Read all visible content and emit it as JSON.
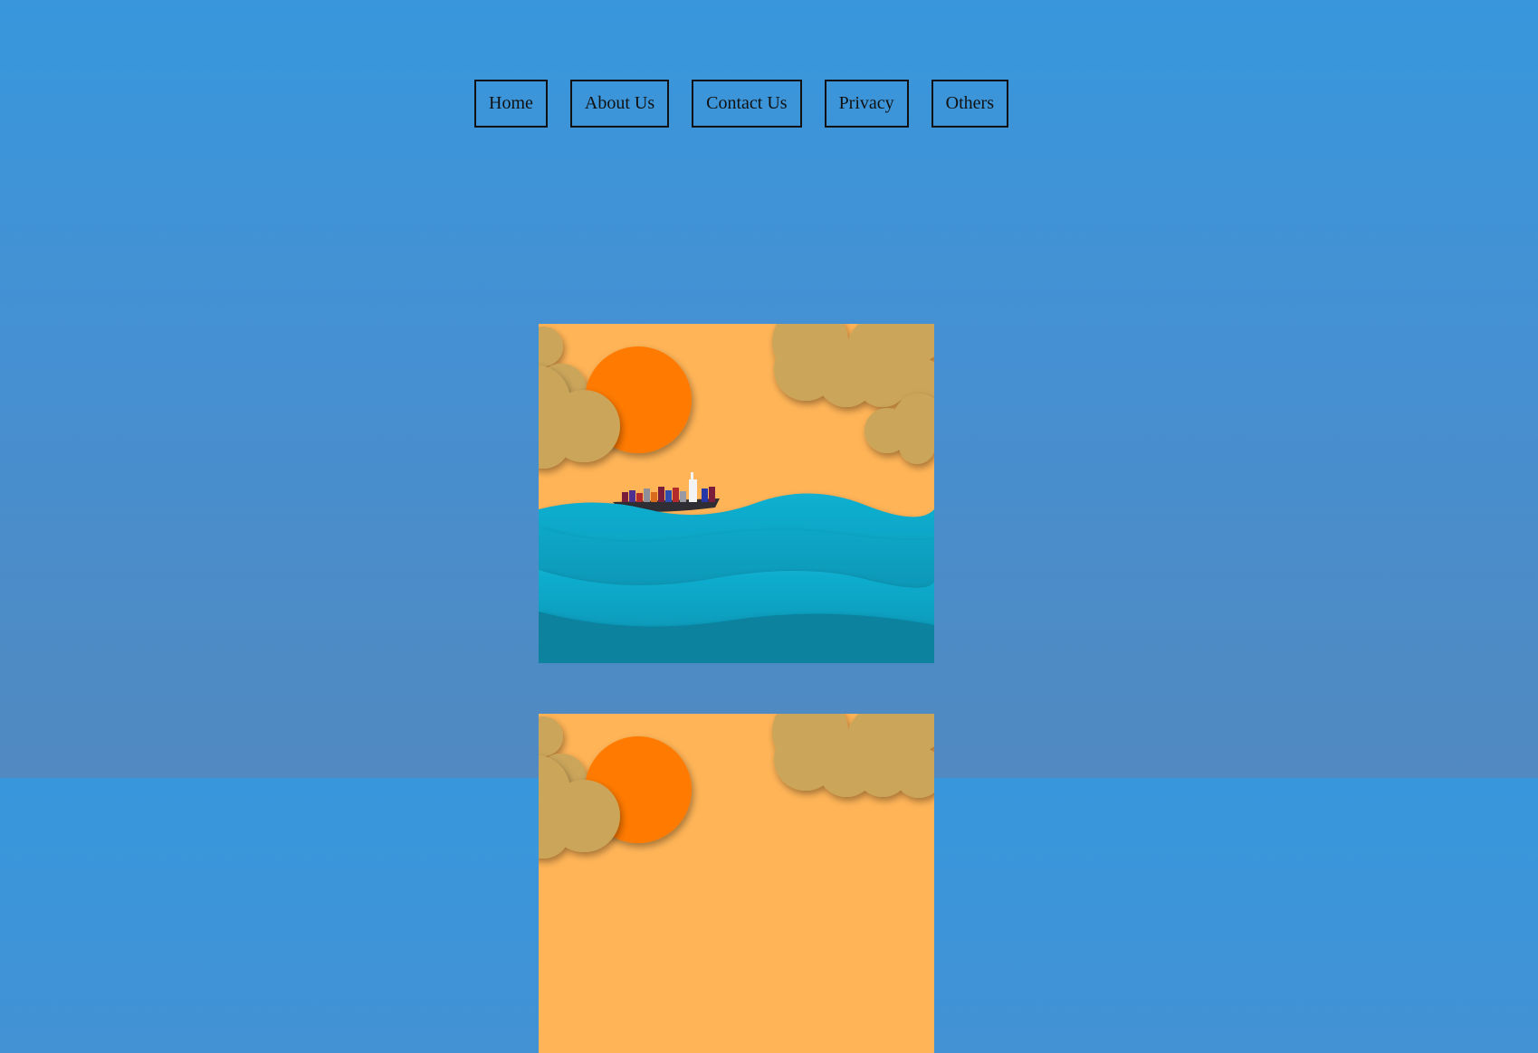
{
  "nav": {
    "items": [
      {
        "label": "Home"
      },
      {
        "label": "About Us"
      },
      {
        "label": "Contact Us"
      },
      {
        "label": "Privacy"
      },
      {
        "label": "Others"
      }
    ]
  },
  "colors": {
    "background_top": "#3897dc",
    "background_bottom": "#5189c0",
    "sky": "#ffb457",
    "sun": "#ff7a00",
    "cloud": "#caa55a",
    "sea_light": "#0aa0c2",
    "sea_deep": "#07829f"
  },
  "artwork": [
    {
      "subject": "paper-cut-seascape-with-cargo-ship"
    },
    {
      "subject": "paper-cut-seascape-with-cargo-ship"
    }
  ]
}
